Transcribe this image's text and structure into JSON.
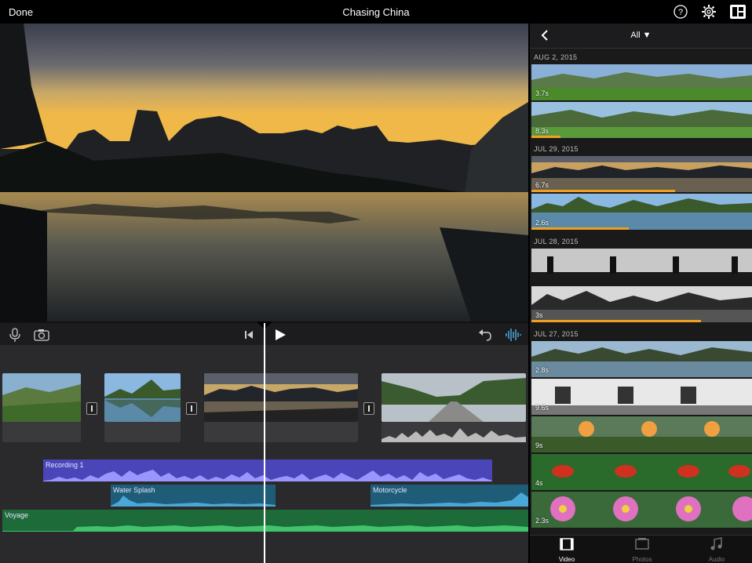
{
  "topbar": {
    "done_label": "Done",
    "title": "Chasing China"
  },
  "icons": {
    "help": "help-icon",
    "settings": "gear-icon",
    "project": "project-browser-icon"
  },
  "controls": {
    "mic": "microphone-icon",
    "camera": "camera-icon",
    "skip_back": "skip-to-start-icon",
    "play": "play-icon",
    "undo": "undo-icon",
    "audio_wave": "waveform-icon"
  },
  "timeline": {
    "audio_tracks": [
      {
        "label": "Recording 1",
        "color": "#4a45b8"
      },
      {
        "label": "Water Splash",
        "color": "#1f5c78"
      },
      {
        "label": "Motorcycle",
        "color": "#1f5c78"
      },
      {
        "label": "Voyage",
        "color": "#1e6b3a"
      }
    ]
  },
  "browser": {
    "filter_label": "All ▼",
    "dates": [
      "AUG 2, 2015",
      "JUL 29, 2015",
      "JUL 28, 2015",
      "JUL 27, 2015"
    ],
    "clips": [
      {
        "duration": "3.7s",
        "used": 0
      },
      {
        "duration": "8.3s",
        "used": 0.13
      },
      {
        "duration": "6.7s",
        "used": 0.65
      },
      {
        "duration": "2.6s",
        "used": 0.44
      },
      {
        "duration": "",
        "used": 0
      },
      {
        "duration": "3s",
        "used": 0.77
      },
      {
        "duration": "2.8s",
        "used": 0
      },
      {
        "duration": "9.6s",
        "used": 0
      },
      {
        "duration": "9s",
        "used": 0
      },
      {
        "duration": "4s",
        "used": 0
      },
      {
        "duration": "2.3s",
        "used": 0
      }
    ],
    "tabs": [
      {
        "label": "Video",
        "icon": "film-icon",
        "active": true
      },
      {
        "label": "Photos",
        "icon": "photos-icon",
        "active": false
      },
      {
        "label": "Audio",
        "icon": "music-note-icon",
        "active": false
      }
    ]
  },
  "colors": {
    "accent": "#f0a020",
    "waveform_blue": "#4aa8d8",
    "waveform_green": "#3fc46a",
    "waveform_purple": "#9a95ff"
  }
}
